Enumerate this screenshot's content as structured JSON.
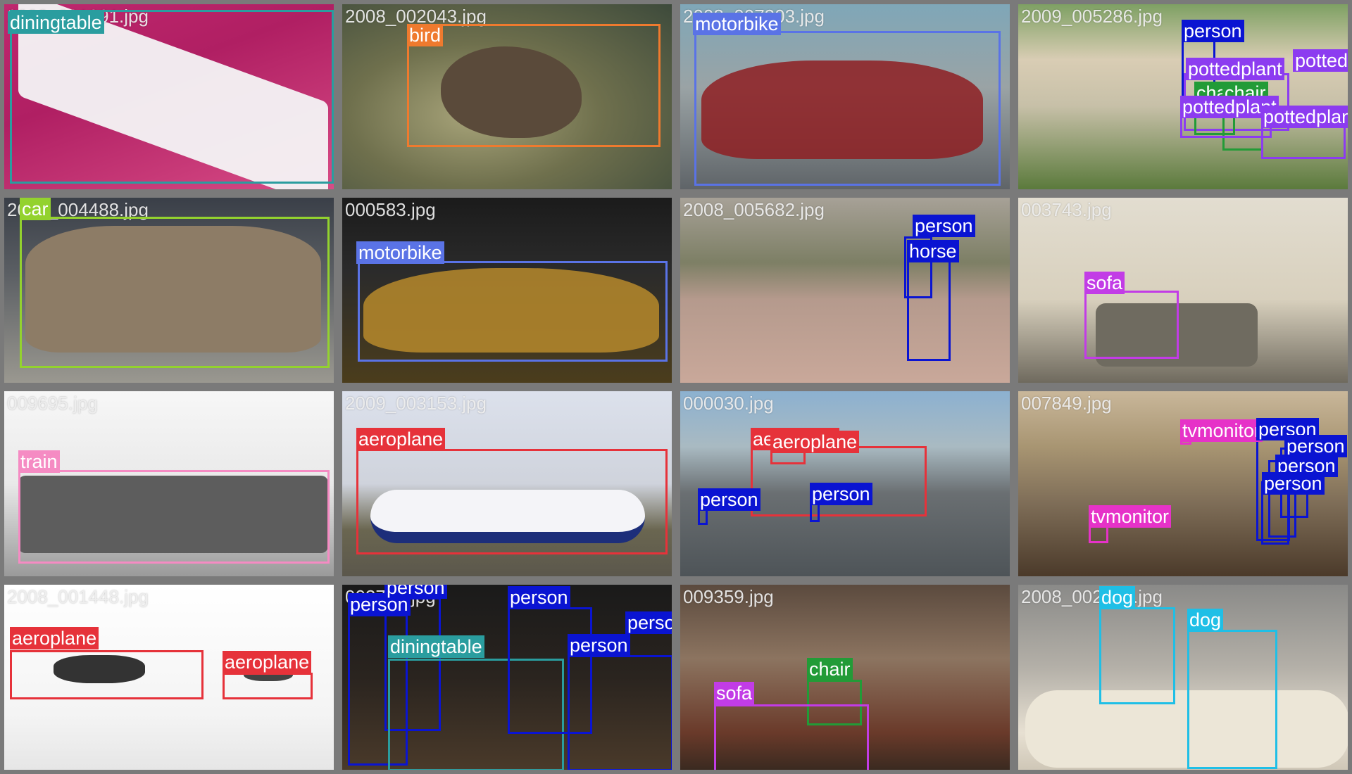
{
  "colors": {
    "diningtable": "#2a9d9f",
    "bird": "#ef7a2e",
    "motorbike": "#5a73e6",
    "person": "#0a14d2",
    "pottedplant": "#8c3cf0",
    "chair": "#229b37",
    "car": "#93d22e",
    "horse": "#0a14d2",
    "sofa": "#c23ce6",
    "train": "#f58bc3",
    "aeroplane": "#e6323a",
    "tvmonitor": "#e632c8",
    "dog": "#1fbfe6"
  },
  "tiles": [
    {
      "filename": "2008_001091.jpg",
      "labels": [
        "diningtable"
      ]
    },
    {
      "filename": "2008_002043.jpg",
      "labels": [
        "bird"
      ]
    },
    {
      "filename": "2008_007303.jpg",
      "labels": [
        "motorbike"
      ]
    },
    {
      "filename": "2009_005286.jpg",
      "labels": [
        "person",
        "pottedplant",
        "chair",
        "chair",
        "pottedplant",
        "pottedplant",
        "pottedplant"
      ]
    },
    {
      "filename": "2008_004488.jpg",
      "labels": [
        "car"
      ]
    },
    {
      "filename": "000583.jpg",
      "labels": [
        "motorbike"
      ]
    },
    {
      "filename": "2008_005682.jpg",
      "labels": [
        "person",
        "horse"
      ]
    },
    {
      "filename": "003743.jpg",
      "labels": [
        "sofa"
      ]
    },
    {
      "filename": "009695.jpg",
      "labels": [
        "train"
      ]
    },
    {
      "filename": "2009_003153.jpg",
      "labels": [
        "aeroplane"
      ]
    },
    {
      "filename": "000030.jpg",
      "labels": [
        "aeroplane",
        "aeroplane",
        "person",
        "person"
      ]
    },
    {
      "filename": "007849.jpg",
      "labels": [
        "tvmonitor",
        "person",
        "person",
        "person",
        "person",
        "tvmonitor"
      ]
    },
    {
      "filename": "2008_001448.jpg",
      "labels": [
        "aeroplane",
        "aeroplane"
      ]
    },
    {
      "filename": "002743.jpg",
      "labels": [
        "person",
        "person",
        "diningtable",
        "person",
        "person",
        "person"
      ]
    },
    {
      "filename": "009359.jpg",
      "labels": [
        "chair",
        "sofa"
      ]
    },
    {
      "filename": "2008_002062.jpg",
      "labels": [
        "dog",
        "dog"
      ]
    }
  ]
}
